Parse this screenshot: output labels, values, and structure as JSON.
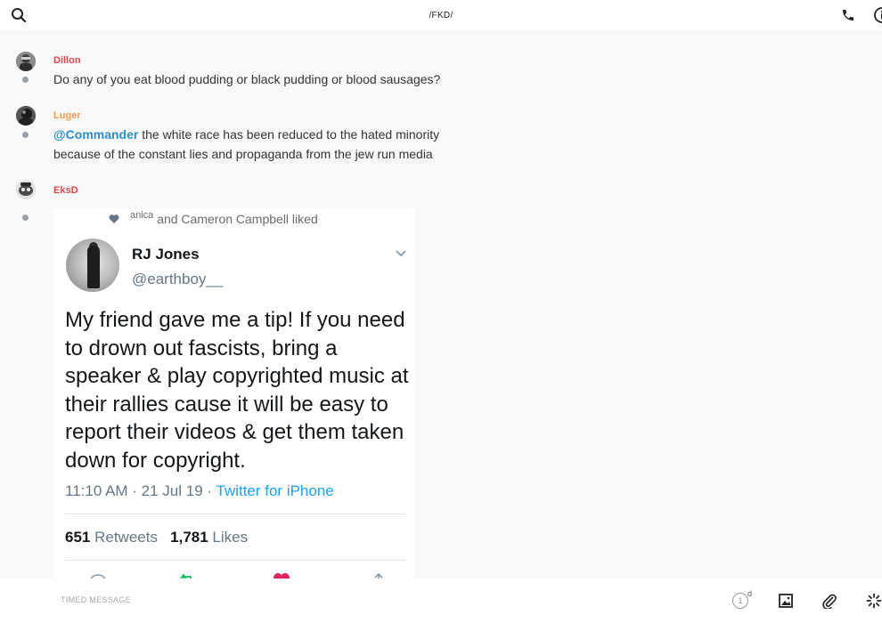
{
  "header": {
    "title": "/FKD/"
  },
  "messages": [
    {
      "author": "Dillon",
      "author_color": "#e0474c",
      "text": "Do any of you eat blood pudding or black pudding or blood sausages?"
    },
    {
      "author": "Luger",
      "author_color": "#f2994a",
      "mention": "@Commander",
      "text": " the white race has been reduced to the hated minority because of the constant lies and propaganda from the jew run media"
    },
    {
      "author": "EksD",
      "author_color": "#e0474c",
      "tweet": {
        "liked_by_prefix": "anica",
        "liked_by_suffix": " and Cameron Campbell liked",
        "name": "RJ Jones",
        "handle": "@earthboy__",
        "body": "My friend gave me a tip! If you need to drown out fascists, bring a speaker & play copyrighted music at their rallies cause it will be easy to report their videos & get them taken down for copyright.",
        "time": "11:10 AM · 21 Jul 19 · ",
        "source": "Twitter for iPhone",
        "retweets_count": "651",
        "retweets_label": " Retweets",
        "likes_count": "1,781",
        "likes_label": " Likes"
      }
    }
  ],
  "composer": {
    "placeholder": "TIMED MESSAGE",
    "timer_value": "1",
    "timer_unit": "d"
  },
  "colors": {
    "mention": "#2a8fcf",
    "link": "#1da1f2",
    "background": "#f9f9f9"
  },
  "icons": [
    "search-icon",
    "phone-icon",
    "info-icon",
    "heart-icon",
    "chevron-down-icon",
    "reply-icon",
    "retweet-icon",
    "share-icon",
    "image-icon",
    "paperclip-icon",
    "sparkle-icon"
  ]
}
